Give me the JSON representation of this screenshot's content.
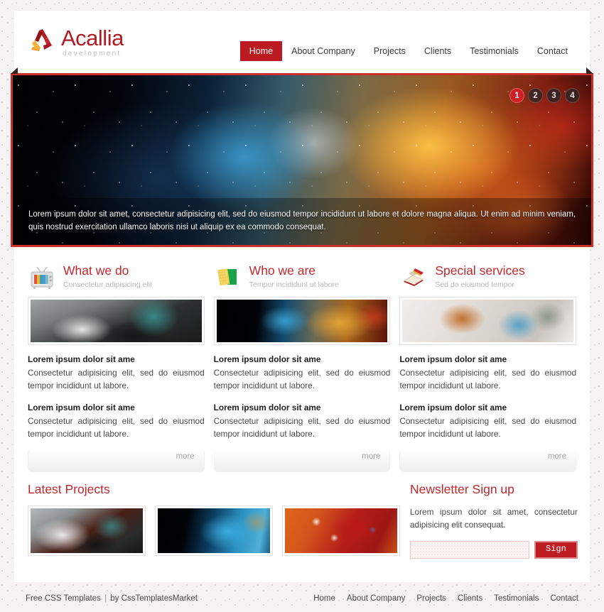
{
  "site": {
    "logo_title": "Acallia",
    "logo_subtitle": "development",
    "accent_color": "#bb1a20",
    "title_color": "#c3272b"
  },
  "nav": {
    "items": [
      {
        "label": "Home",
        "active": true
      },
      {
        "label": "About Company",
        "active": false
      },
      {
        "label": "Projects",
        "active": false
      },
      {
        "label": "Clients",
        "active": false
      },
      {
        "label": "Testimonials",
        "active": false
      },
      {
        "label": "Contact",
        "active": false
      }
    ]
  },
  "banner": {
    "caption": "Lorem ipsum dolor sit amet, consectetur adipisicing elit, sed do eiusmod tempor incididunt ut labore et dolore magna aliqua. Ut enim ad minim veniam, quis nostrud exercitation ullamco laboris nisi ut aliquip ex ea commodo consequat.",
    "pager": [
      "1",
      "2",
      "3",
      "4"
    ],
    "active_slide": "1"
  },
  "columns": [
    {
      "title": "What we do",
      "subtitle": "Consectetur adipisicing elit",
      "icon": "television-icon",
      "more_label": "more",
      "entries": [
        {
          "title": "Lorem ipsum dolor sit ame",
          "text": "Consectetur adipisicing elit, sed do eiusmod tempor incididunt ut labore."
        },
        {
          "title": "Lorem ipsum dolor sit ame",
          "text": "Consectetur adipisicing elit, sed do eiusmod tempor incididunt ut labore."
        }
      ]
    },
    {
      "title": "Who we are",
      "subtitle": "Tempor incididunt ut labore",
      "icon": "books-icon",
      "more_label": "more",
      "entries": [
        {
          "title": "Lorem ipsum dolor sit ame",
          "text": "Consectetur adipisicing elit, sed do eiusmod tempor incididunt ut labore."
        },
        {
          "title": "Lorem ipsum dolor sit ame",
          "text": "Consectetur adipisicing elit, sed do eiusmod tempor incididunt ut labore."
        }
      ]
    },
    {
      "title": "Special services",
      "subtitle": "Sed do eiusmod tempor",
      "icon": "open-book-icon",
      "more_label": "more",
      "entries": [
        {
          "title": "Lorem ipsum dolor sit ame",
          "text": "Consectetur adipisicing elit, sed do eiusmod tempor incididunt ut labore."
        },
        {
          "title": "Lorem ipsum dolor sit ame",
          "text": "Consectetur adipisicing elit, sed do eiusmod tempor incididunt ut labore."
        }
      ]
    }
  ],
  "latest_projects": {
    "title": "Latest Projects",
    "thumbs": [
      "project-thumb-gray",
      "project-thumb-blue",
      "project-thumb-red"
    ]
  },
  "newsletter": {
    "title": "Newsletter Sign up",
    "text": "Lorem ipsum dolor sit amet, consectetur adipisicing elit consequat.",
    "input_value": "",
    "input_placeholder": "",
    "button_label": "Sign up"
  },
  "footer": {
    "credit_left": "Free CSS Templates",
    "credit_sep": "|",
    "credit_right": "by CssTemplatesMarket",
    "nav": [
      "Home",
      "About Company",
      "Projects",
      "Clients",
      "Testimonials",
      "Contact"
    ]
  }
}
